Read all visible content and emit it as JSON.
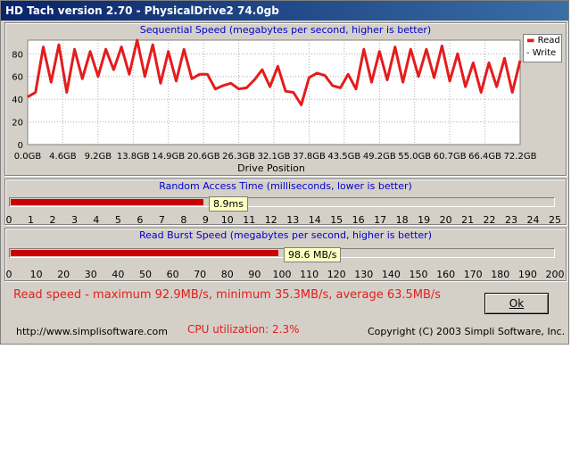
{
  "window": {
    "title": "HD Tach version 2.70 - PhysicalDrive2 74.0gb"
  },
  "sequential": {
    "caption": "Sequential Speed (megabytes per second, higher is better)",
    "xlabel": "Drive Position",
    "legend": {
      "read": "Read",
      "write": "Write"
    },
    "read_color": "#e41c1c"
  },
  "chart_data": {
    "type": "line",
    "title": "Sequential Speed (megabytes per second, higher is better)",
    "xlabel": "Drive Position",
    "ylabel": "",
    "ylim": [
      0,
      92
    ],
    "yticks": [
      "80",
      "60",
      "40",
      "20",
      "0"
    ],
    "xticks": [
      "0.0GB",
      "4.6GB",
      "9.2GB",
      "13.8GB",
      "14.9GB",
      "20.6GB",
      "26.3GB",
      "32.1GB",
      "37.8GB",
      "43.5GB",
      "49.2GB",
      "55.0GB",
      "60.7GB",
      "66.4GB",
      "72.2GB"
    ],
    "x_range_gb": [
      0,
      74
    ],
    "series": [
      {
        "name": "Read",
        "values": [
          42,
          46,
          86,
          55,
          88,
          46,
          84,
          58,
          82,
          60,
          84,
          66,
          86,
          62,
          92,
          60,
          88,
          54,
          82,
          56,
          84,
          58,
          62,
          62,
          49,
          52,
          54,
          49,
          50,
          57,
          66,
          51,
          69,
          47,
          46,
          35,
          59,
          63,
          61,
          52,
          50,
          62,
          49,
          84,
          55,
          82,
          57,
          86,
          55,
          84,
          60,
          84,
          59,
          87,
          56,
          80,
          51,
          72,
          46,
          72,
          51,
          76,
          46,
          74
        ]
      },
      {
        "name": "Write",
        "values": []
      }
    ],
    "legend": "top-right"
  },
  "random_access": {
    "caption": "Random Access Time (milliseconds, lower is better)",
    "value": 8.9,
    "max": 25,
    "label": "8.9ms",
    "scale": [
      "0",
      "1",
      "2",
      "3",
      "4",
      "5",
      "6",
      "7",
      "8",
      "9",
      "10",
      "11",
      "12",
      "13",
      "14",
      "15",
      "16",
      "17",
      "18",
      "19",
      "20",
      "21",
      "22",
      "23",
      "24",
      "25"
    ]
  },
  "burst": {
    "caption": "Read Burst Speed (megabytes per second, higher is better)",
    "value": 98.6,
    "max": 200,
    "label": "98.6 MB/s",
    "scale": [
      "0",
      "10",
      "20",
      "30",
      "40",
      "50",
      "60",
      "70",
      "80",
      "90",
      "100",
      "110",
      "120",
      "130",
      "140",
      "150",
      "160",
      "170",
      "180",
      "190",
      "200"
    ]
  },
  "summary": "Read speed - maximum 92.9MB/s, minimum 35.3MB/s, average 63.5MB/s",
  "ok_label": "Ok",
  "footer": {
    "url": "http://www.simplisoftware.com",
    "cpu": "CPU utilization: 2.3%",
    "copyright": "Copyright (C) 2003 Simpli Software, Inc."
  },
  "colors": {
    "accent_red": "#cc0000",
    "caption_blue": "#0000cc",
    "titlebar": "#0a246a"
  }
}
